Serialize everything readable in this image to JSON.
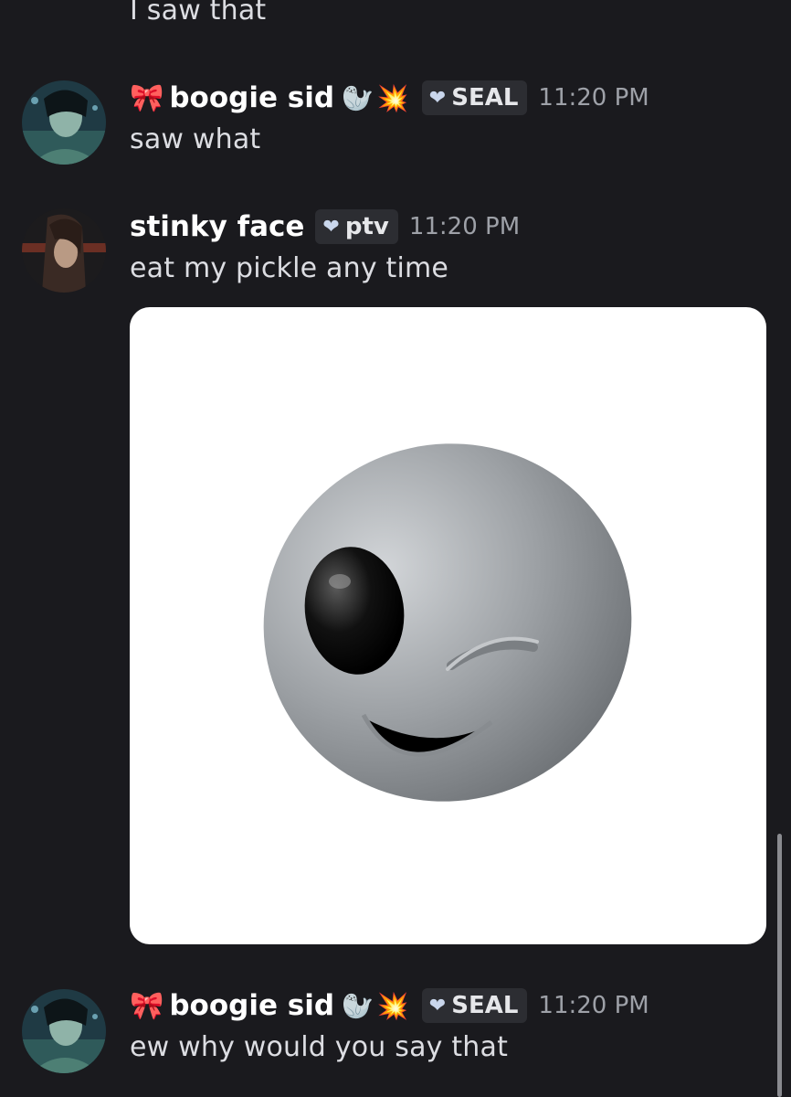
{
  "messages": [
    {
      "text": "I saw that"
    },
    {
      "author": {
        "prefix_icon": "ribbon-icon",
        "prefix_char": "🎀",
        "name": "boogie sid",
        "emojis": [
          "🦭",
          "💥"
        ]
      },
      "tag": {
        "icon": "heart-icon",
        "label": "SEAL"
      },
      "timestamp": "11:20 PM",
      "text": "saw what"
    },
    {
      "author": {
        "name": "stinky face"
      },
      "tag": {
        "icon": "heart-icon",
        "label": "ptv"
      },
      "timestamp": "11:20 PM",
      "text": "eat my pickle any time",
      "attachment": {
        "type": "image",
        "subject": "winking-alien-memoji"
      }
    },
    {
      "author": {
        "prefix_icon": "ribbon-icon",
        "prefix_char": "🎀",
        "name": "boogie sid",
        "emojis": [
          "🦭",
          "💥"
        ]
      },
      "tag": {
        "icon": "heart-icon",
        "label": "SEAL"
      },
      "timestamp": "11:20 PM",
      "text": "ew why would you say that"
    }
  ],
  "colors": {
    "background": "#1a1a1e",
    "message_text": "#dcdde2",
    "username": "#ffffff",
    "timestamp": "#9ea1a8",
    "tag_bg": "#2c2d32"
  }
}
